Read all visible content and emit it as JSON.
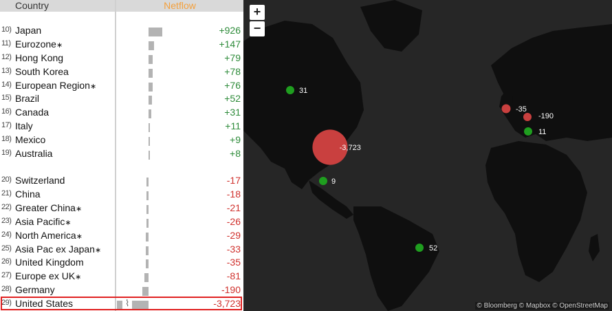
{
  "table": {
    "header_country": "Country",
    "header_netflow": "Netflow",
    "rows": [
      {
        "rank": "10)",
        "country": "Japan",
        "value": "+926",
        "sign": "pos",
        "magnitude": 926
      },
      {
        "rank": "11)",
        "country": "Eurozone",
        "star": "∗",
        "value": "+147",
        "sign": "pos",
        "magnitude": 147
      },
      {
        "rank": "12)",
        "country": "Hong Kong",
        "value": "+79",
        "sign": "pos",
        "magnitude": 79
      },
      {
        "rank": "13)",
        "country": "South Korea",
        "value": "+78",
        "sign": "pos",
        "magnitude": 78
      },
      {
        "rank": "14)",
        "country": "European Region",
        "star": "∗",
        "value": "+76",
        "sign": "pos",
        "magnitude": 76
      },
      {
        "rank": "15)",
        "country": "Brazil",
        "value": "+52",
        "sign": "pos",
        "magnitude": 52
      },
      {
        "rank": "16)",
        "country": "Canada",
        "value": "+31",
        "sign": "pos",
        "magnitude": 31
      },
      {
        "rank": "17)",
        "country": "Italy",
        "value": "+11",
        "sign": "pos",
        "magnitude": 11
      },
      {
        "rank": "18)",
        "country": "Mexico",
        "value": "+9",
        "sign": "pos",
        "magnitude": 9
      },
      {
        "rank": "19)",
        "country": "Australia",
        "value": "+8",
        "sign": "pos",
        "magnitude": 8
      },
      {
        "rank": "20)",
        "country": "Switzerland",
        "value": "-17",
        "sign": "neg",
        "magnitude": 17
      },
      {
        "rank": "21)",
        "country": "China",
        "value": "-18",
        "sign": "neg",
        "magnitude": 18
      },
      {
        "rank": "22)",
        "country": "Greater China",
        "star": "∗",
        "value": "-21",
        "sign": "neg",
        "magnitude": 21
      },
      {
        "rank": "23)",
        "country": "Asia Pacific",
        "star": "∗",
        "value": "-26",
        "sign": "neg",
        "magnitude": 26
      },
      {
        "rank": "24)",
        "country": "North America",
        "star": "∗",
        "value": "-29",
        "sign": "neg",
        "magnitude": 29
      },
      {
        "rank": "25)",
        "country": "Asia Pac ex Japan",
        "star": "∗",
        "value": "-33",
        "sign": "neg",
        "magnitude": 33
      },
      {
        "rank": "26)",
        "country": "United Kingdom",
        "value": "-35",
        "sign": "neg",
        "magnitude": 35
      },
      {
        "rank": "27)",
        "country": "Europe ex UK",
        "star": "∗",
        "value": "-81",
        "sign": "neg",
        "magnitude": 81
      },
      {
        "rank": "28)",
        "country": "Germany",
        "value": "-190",
        "sign": "neg",
        "magnitude": 190
      },
      {
        "rank": "29)",
        "country": "United States",
        "value": "-3,723",
        "sign": "neg",
        "magnitude": 3723,
        "highlighted": true
      }
    ],
    "break_mark": "⌇"
  },
  "map": {
    "zoom_in": "+",
    "zoom_out": "−",
    "attribution": "© Bloomberg © Mapbox © OpenStreetMap",
    "colors": {
      "positive": "#1f9e1f",
      "negative": "#c9403f",
      "land": "#0f0f0f",
      "water": "#262626"
    },
    "bubbles": [
      {
        "country": "Canada",
        "label": "31",
        "sign": "pos",
        "magnitude": 31
      },
      {
        "country": "United States",
        "label": "-3,723",
        "sign": "neg",
        "magnitude": 3723
      },
      {
        "country": "Mexico",
        "label": "9",
        "sign": "pos",
        "magnitude": 9
      },
      {
        "country": "Brazil",
        "label": "52",
        "sign": "pos",
        "magnitude": 52
      },
      {
        "country": "United Kingdom",
        "label": "-35",
        "sign": "neg",
        "magnitude": 35
      },
      {
        "country": "Germany",
        "label": "-190",
        "sign": "neg",
        "magnitude": 190
      },
      {
        "country": "Italy",
        "label": "11",
        "sign": "pos",
        "magnitude": 11
      }
    ]
  }
}
